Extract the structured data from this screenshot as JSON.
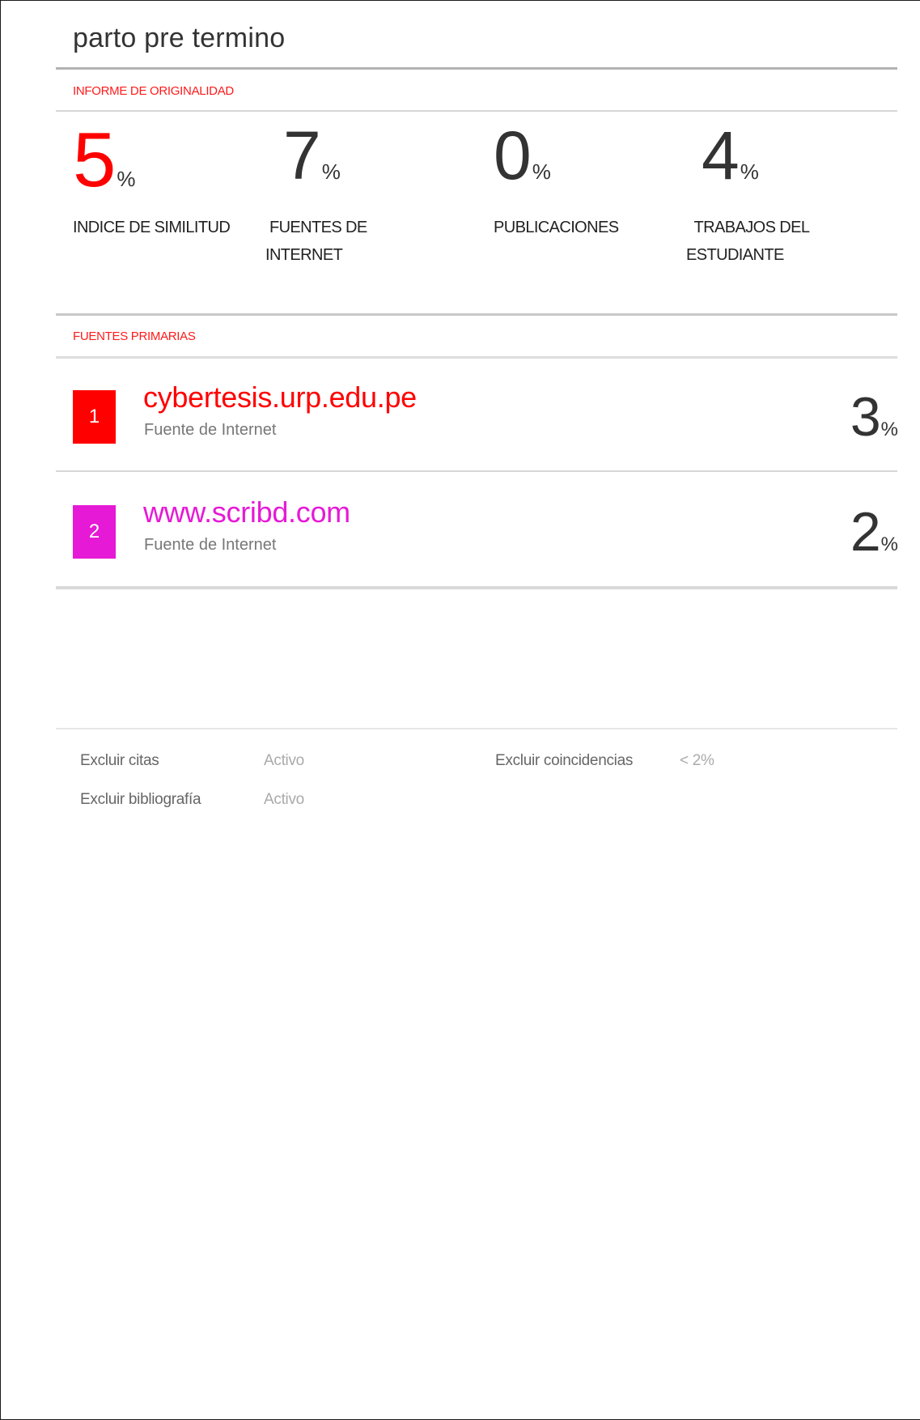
{
  "document": {
    "title": "parto pre termino"
  },
  "report": {
    "heading": "INFORME DE ORIGINALIDAD",
    "stats": [
      {
        "value": "5",
        "unit": "%",
        "label": "INDICE DE SIMILITUD",
        "color": "#ff0000"
      },
      {
        "value": "7",
        "unit": "%",
        "label": " FUENTES DE\nINTERNET",
        "color": "#333333"
      },
      {
        "value": "0",
        "unit": "%",
        "label": "PUBLICACIONES",
        "color": "#333333"
      },
      {
        "value": "4",
        "unit": "%",
        "label": "  TRABAJOS DEL\nESTUDIANTE",
        "color": "#333333"
      }
    ]
  },
  "primary_sources": {
    "heading": "FUENTES PRIMARIAS",
    "items": [
      {
        "rank": "1",
        "name": "cybertesis.urp.edu.pe",
        "type": "Fuente de Internet",
        "percent": "3",
        "unit": "%",
        "color": "#ff0000"
      },
      {
        "rank": "2",
        "name": "www.scribd.com",
        "type": "Fuente de Internet",
        "percent": "2",
        "unit": "%",
        "color": "#e619d6"
      }
    ]
  },
  "settings": {
    "exclude_quotes": {
      "label": "Excluir citas",
      "value": "Activo"
    },
    "exclude_bibliography": {
      "label": "Excluir bibliografía",
      "value": "Activo"
    },
    "exclude_matches": {
      "label": "Excluir coincidencias",
      "value": "< 2%"
    }
  }
}
